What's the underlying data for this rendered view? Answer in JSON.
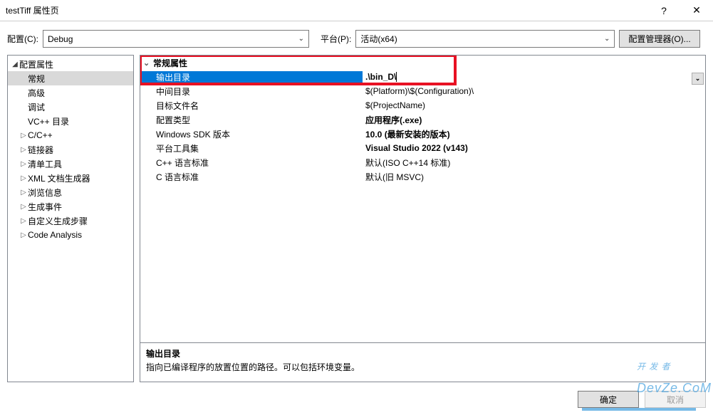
{
  "title": "testTiff 属性页",
  "titlebar": {
    "help": "?",
    "close": "✕"
  },
  "config": {
    "label": "配置(C):",
    "value": "Debug",
    "platform_label": "平台(P):",
    "platform_value": "活动(x64)",
    "manager_btn": "配置管理器(O)..."
  },
  "tree": [
    {
      "label": "配置属性",
      "expanded": true,
      "level": 0
    },
    {
      "label": "常规",
      "level": 1,
      "selected": true
    },
    {
      "label": "高级",
      "level": 1
    },
    {
      "label": "调试",
      "level": 1
    },
    {
      "label": "VC++ 目录",
      "level": 1
    },
    {
      "label": "C/C++",
      "level": 1,
      "expandable": true
    },
    {
      "label": "链接器",
      "level": 1,
      "expandable": true
    },
    {
      "label": "清单工具",
      "level": 1,
      "expandable": true
    },
    {
      "label": "XML 文档生成器",
      "level": 1,
      "expandable": true
    },
    {
      "label": "浏览信息",
      "level": 1,
      "expandable": true
    },
    {
      "label": "生成事件",
      "level": 1,
      "expandable": true
    },
    {
      "label": "自定义生成步骤",
      "level": 1,
      "expandable": true
    },
    {
      "label": "Code Analysis",
      "level": 1,
      "expandable": true
    }
  ],
  "group": {
    "title": "常规属性"
  },
  "props": [
    {
      "name": "输出目录",
      "value": ".\\bin_D\\",
      "selected": true
    },
    {
      "name": "中间目录",
      "value": "$(Platform)\\$(Configuration)\\"
    },
    {
      "name": "目标文件名",
      "value": "$(ProjectName)"
    },
    {
      "name": "配置类型",
      "value": "应用程序(.exe)",
      "bold": true
    },
    {
      "name": "Windows SDK 版本",
      "value": "10.0 (最新安装的版本)",
      "bold": true
    },
    {
      "name": "平台工具集",
      "value": "Visual Studio 2022 (v143)",
      "bold": true
    },
    {
      "name": "C++ 语言标准",
      "value": "默认(ISO C++14 标准)"
    },
    {
      "name": "C 语言标准",
      "value": "默认(旧 MSVC)"
    }
  ],
  "desc": {
    "title": "输出目录",
    "text": "指向已编译程序的放置位置的路径。可以包括环境变量。"
  },
  "buttons": {
    "ok": "确定",
    "cancel": "取消"
  },
  "watermark": "开 发 者",
  "watermark2": "DevZe.CoM"
}
